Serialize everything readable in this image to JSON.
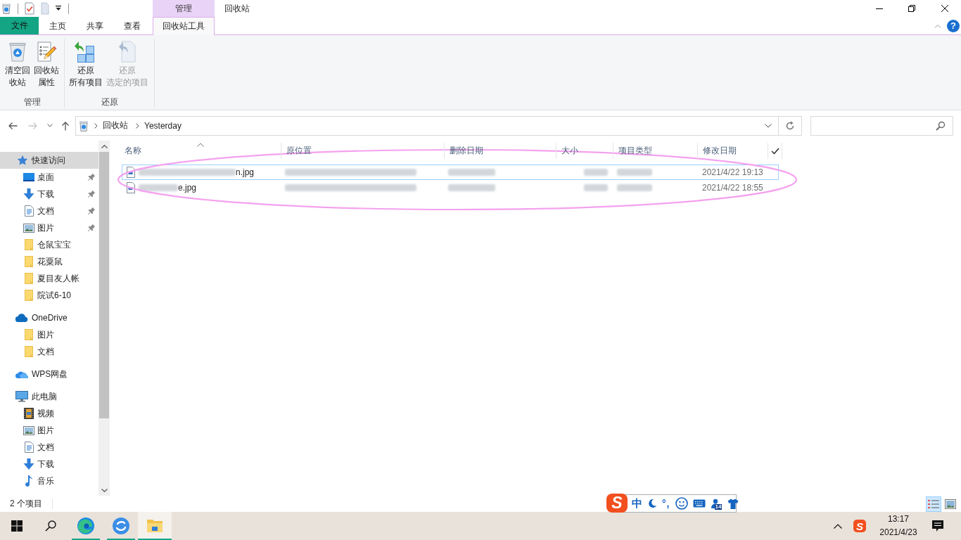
{
  "window": {
    "title": "回收站",
    "context_label": "管理",
    "help": "?"
  },
  "ribbon": {
    "tabs": [
      {
        "label": "文件",
        "kind": "file",
        "selected": false
      },
      {
        "label": "主页",
        "kind": "tab",
        "selected": false
      },
      {
        "label": "共享",
        "kind": "tab",
        "selected": false
      },
      {
        "label": "查看",
        "kind": "tab",
        "selected": false
      },
      {
        "label": "回收站工具",
        "kind": "context",
        "selected": true
      }
    ],
    "groups": [
      {
        "label": "管理",
        "buttons": [
          {
            "lines": [
              "清空回",
              "收站"
            ],
            "kind": "empty-bin",
            "disabled": false
          },
          {
            "lines": [
              "回收站",
              "属性"
            ],
            "kind": "properties",
            "disabled": false
          }
        ]
      },
      {
        "label": "还原",
        "buttons": [
          {
            "lines": [
              "还原",
              "所有项目"
            ],
            "kind": "restore-all",
            "disabled": false
          },
          {
            "lines": [
              "还原",
              "选定的项目"
            ],
            "kind": "restore-selected",
            "disabled": true
          }
        ]
      }
    ]
  },
  "address": {
    "nav_buttons": [
      {
        "kind": "back",
        "disabled": false
      },
      {
        "kind": "forward",
        "disabled": true
      },
      {
        "kind": "recent",
        "disabled": false
      },
      {
        "kind": "up",
        "disabled": false
      }
    ],
    "breadcrumbs": [
      "回收站",
      "Yesterday"
    ]
  },
  "navigation": [
    {
      "label": "快速访问",
      "kind": "star",
      "selected": true,
      "children": [
        {
          "label": "桌面",
          "kind": "desktop",
          "pinned": true,
          "selected": false
        },
        {
          "label": "下载",
          "kind": "download",
          "pinned": true,
          "selected": false
        },
        {
          "label": "文档",
          "kind": "document",
          "pinned": true,
          "selected": false
        },
        {
          "label": "图片",
          "kind": "picture",
          "pinned": true,
          "selected": false
        },
        {
          "label": "仓鼠宝宝",
          "kind": "folder",
          "pinned": false,
          "selected": false
        },
        {
          "label": "花粟鼠",
          "kind": "folder",
          "pinned": false,
          "selected": false
        },
        {
          "label": "夏目友人帐",
          "kind": "folder",
          "pinned": false,
          "selected": false
        },
        {
          "label": "院试6-10",
          "kind": "folder",
          "pinned": false,
          "selected": false
        }
      ]
    },
    {
      "label": "OneDrive",
      "kind": "cloud",
      "selected": false,
      "children": [
        {
          "label": "图片",
          "kind": "folder",
          "pinned": false,
          "selected": false
        },
        {
          "label": "文档",
          "kind": "folder",
          "pinned": false,
          "selected": false
        }
      ]
    },
    {
      "label": "WPS网盘",
      "kind": "cloud-pair",
      "selected": false
    },
    {
      "label": "此电脑",
      "kind": "computer",
      "selected": false,
      "children": [
        {
          "label": "视频",
          "kind": "video",
          "pinned": false,
          "selected": false
        },
        {
          "label": "图片",
          "kind": "picture",
          "pinned": false,
          "selected": false
        },
        {
          "label": "文档",
          "kind": "document",
          "pinned": false,
          "selected": false
        },
        {
          "label": "下载",
          "kind": "download",
          "pinned": false,
          "selected": false
        },
        {
          "label": "音乐",
          "kind": "music",
          "pinned": false,
          "selected": false
        }
      ]
    }
  ],
  "columns": [
    {
      "label": "名称",
      "sorted": true
    },
    {
      "label": "原位置",
      "sorted": false
    },
    {
      "label": "删除日期",
      "sorted": false
    },
    {
      "label": "大小",
      "sorted": false
    },
    {
      "label": "项目类型",
      "sorted": false
    },
    {
      "label": "修改日期",
      "sorted": false
    }
  ],
  "files": [
    {
      "name": "n.jpg",
      "modified": "2021/4/22 19:13",
      "selected": true
    },
    {
      "name": "e.jpg",
      "modified": "2021/4/22 18:55",
      "selected": false
    }
  ],
  "status_bar": {
    "item_count": "2 个项目",
    "views": [
      {
        "kind": "details",
        "selected": true
      },
      {
        "kind": "large-icons",
        "selected": false
      }
    ]
  },
  "ime_bar": {
    "logo": "S",
    "mode": "中",
    "punctuation": "°,",
    "badge": "14"
  },
  "taskbar": {
    "apps": [
      {
        "kind": "edge",
        "running": true,
        "active": false
      },
      {
        "kind": "sogou",
        "running": true,
        "active": false
      },
      {
        "kind": "explorer",
        "running": true,
        "active": true
      }
    ],
    "tray_logo": "S",
    "clock": {
      "time": "13:17",
      "date": "2021/4/23"
    }
  }
}
